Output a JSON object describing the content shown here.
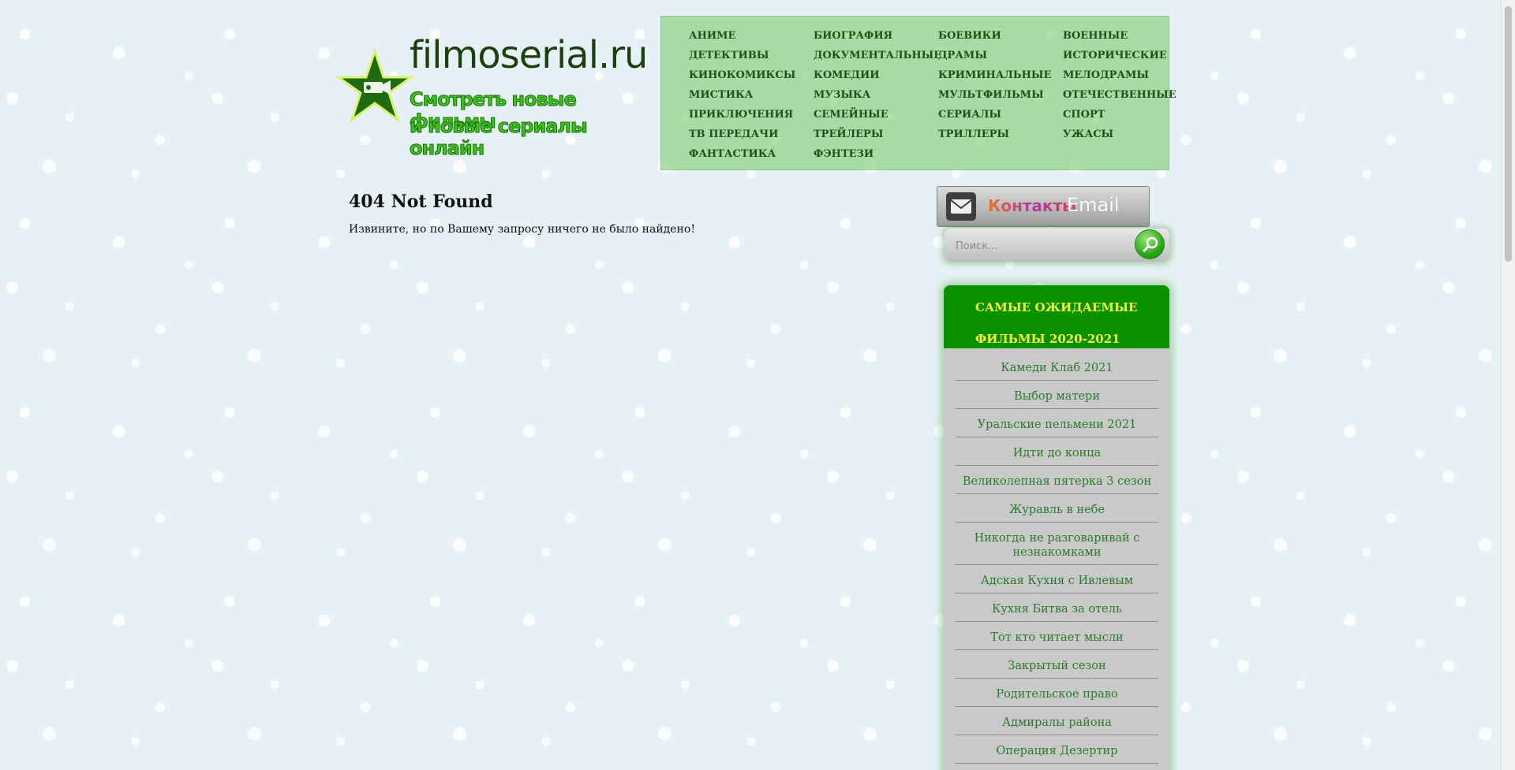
{
  "logo": {
    "domain": "filmoserial.ru",
    "tagline_line1": "Смотреть новые фильмы",
    "tagline_line2": "и новые сериалы онлайн"
  },
  "genres": [
    "АНИМЕ",
    "БИОГРАФИЯ",
    "БОЕВИКИ",
    "ВОЕННЫЕ",
    "ДЕТЕКТИВЫ",
    "ДОКУМЕНТАЛЬНЫЕ",
    "ДРАМЫ",
    "ИСТОРИЧЕСКИЕ",
    "КИНОКОМИКСЫ",
    "КОМЕДИИ",
    "КРИМИНАЛЬНЫЕ",
    "МЕЛОДРАМЫ",
    "МИСТИКА",
    "МУЗЫКА",
    "МУЛЬТФИЛЬМЫ",
    "ОТЕЧЕСТВЕННЫЕ",
    "ПРИКЛЮЧЕНИЯ",
    "СЕМЕЙНЫЕ",
    "СЕРИАЛЫ",
    "СПОРТ",
    "ТВ ПЕРЕДАЧИ",
    "ТРЕЙЛЕРЫ",
    "ТРИЛЛЕРЫ",
    "УЖАСЫ",
    "ФАНТАСТИКА",
    "ФЭНТЕЗИ"
  ],
  "main": {
    "title": "404 Not Found",
    "message": "Извините, но по Вашему запросу ничего не было найдено!"
  },
  "contacts": {
    "label": "Контакты",
    "email_label": "Email"
  },
  "search": {
    "placeholder": "Поиск..."
  },
  "sidebar": {
    "title_line1": "САМЫЕ ОЖИДАЕМЫЕ",
    "title_line2": "ФИЛЬМЫ 2020-2021",
    "items": [
      "Камеди Клаб 2021",
      "Выбор матери",
      "Уральские пельмени 2021",
      "Идти до конца",
      "Великолепная пятерка 3 сезон",
      "Журавль в небе",
      "Никогда не разговаривай с незнакомками",
      "Адская Кухня с Ивлевым",
      "Кухня Битва за отель",
      "Тот кто читает мысли",
      "Закрытый сезон",
      "Родительское право",
      "Адмиралы района",
      "Операция Дезертир"
    ]
  },
  "colors": {
    "nav_background": "#86d078",
    "sidebar_header": "#099100",
    "sidebar_header_text": "#f3f23c",
    "sidebar_link": "#2b7a2b",
    "genre_link": "#1f5216"
  },
  "icons": {
    "logo": "star-film-icon",
    "contacts": "envelope-icon",
    "search": "magnifier-icon"
  }
}
